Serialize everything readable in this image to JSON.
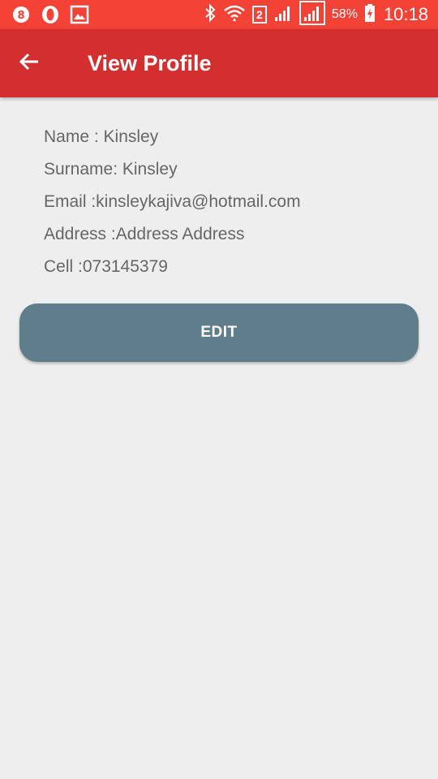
{
  "status_bar": {
    "battery": "58%",
    "time": "10:18",
    "sim_slot": "2",
    "left_icons": [
      "notification-app-icon",
      "opera-browser-icon",
      "image-gallery-icon"
    ],
    "right_icons": [
      "bluetooth-icon",
      "wifi-icon",
      "sim-2-icon",
      "signal-icon",
      "signal-icon",
      "battery-charging-icon"
    ],
    "background": "#f44336"
  },
  "app_bar": {
    "title": "View Profile",
    "back_icon": "arrow-back-icon",
    "background": "#d32f2f"
  },
  "profile": {
    "name": "Name : Kinsley",
    "surname": "Surname: Kinsley",
    "email": "Email :kinsleykajiva@hotmail.com",
    "address": "Address :Address Address",
    "cell": "Cell :073145379"
  },
  "actions": {
    "edit_label": "EDIT",
    "edit_color": "#607d8b"
  }
}
